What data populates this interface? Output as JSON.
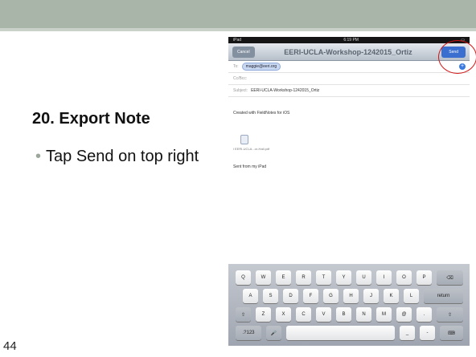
{
  "slide": {
    "title": "20. Export Note",
    "bullets": [
      "Tap Send on top right"
    ],
    "page_number": "44"
  },
  "ipad": {
    "status_left": "iPad",
    "status_time": "6:19 PM",
    "cancel_label": "Cancel",
    "title": "EERI-UCLA-Workshop-1242015_Ortiz",
    "send_label": "Send",
    "to_label": "To:",
    "to_recipient": "maggie@eeri.org",
    "ccbcc_label": "Cc/Bcc:",
    "subject_label": "Subject:",
    "subject_value": "EERI-UCLA-Workshop-1242015_Ortiz",
    "body_line1": "Created with FieldNotes for iOS",
    "attachment_name": "l EERI-UCLA...or-Hall.pdf",
    "signature": "Sent from my iPad",
    "keyboard": {
      "row1": [
        "Q",
        "W",
        "E",
        "R",
        "T",
        "Y",
        "U",
        "I",
        "O",
        "P",
        "⌫"
      ],
      "row2": [
        "A",
        "S",
        "D",
        "F",
        "G",
        "H",
        "J",
        "K",
        "L",
        "return"
      ],
      "row3": [
        "⇧",
        "Z",
        "X",
        "C",
        "V",
        "B",
        "N",
        "M",
        "@",
        ".",
        "⇧"
      ],
      "row4": [
        ".?123",
        "🎤",
        "",
        "_",
        "-",
        "⌨"
      ]
    }
  }
}
